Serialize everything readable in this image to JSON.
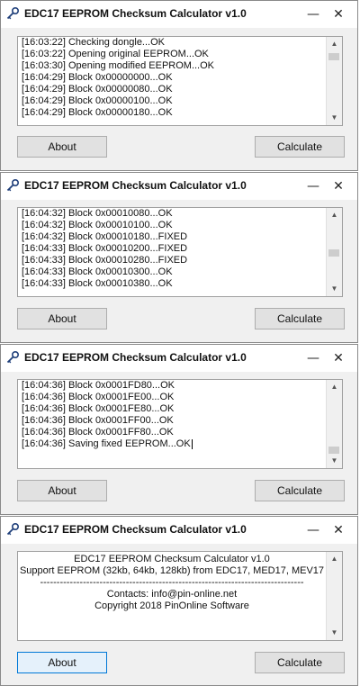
{
  "app": {
    "title": "EDC17 EEPROM Checksum Calculator v1.0",
    "minimize_glyph": "—",
    "close_glyph": "✕",
    "about_label": "About",
    "calculate_label": "Calculate"
  },
  "windows": [
    {
      "log": [
        "[16:03:22] Checking dongle...OK",
        "[16:03:22] Opening original EEPROM...OK",
        "[16:03:30] Opening modified EEPROM...OK",
        "[16:04:29] Block 0x00000000...OK",
        "[16:04:29] Block 0x00000080...OK",
        "[16:04:29] Block 0x00000100...OK",
        "[16:04:29] Block 0x00000180...OK"
      ]
    },
    {
      "log": [
        "[16:04:32] Block 0x00010080...OK",
        "[16:04:32] Block 0x00010100...OK",
        "[16:04:32] Block 0x00010180...FIXED",
        "[16:04:33] Block 0x00010200...FIXED",
        "[16:04:33] Block 0x00010280...FIXED",
        "[16:04:33] Block 0x00010300...OK",
        "[16:04:33] Block 0x00010380...OK"
      ]
    },
    {
      "log": [
        "[16:04:36] Block 0x0001FD80...OK",
        "[16:04:36] Block 0x0001FE00...OK",
        "[16:04:36] Block 0x0001FE80...OK",
        "[16:04:36] Block 0x0001FF00...OK",
        "[16:04:36] Block 0x0001FF80...OK",
        "[16:04:36] Saving fixed EEPROM...OK"
      ]
    },
    {
      "about": [
        "EDC17 EEPROM Checksum Calculator v1.0",
        "Support EEPROM (32kb, 64kb, 128kb) from EDC17, MED17, MEV17",
        "--------------------------------------------------------------------------------",
        "Contacts: info@pin-online.net",
        "Copyright 2018 PinOnline Software"
      ]
    }
  ]
}
